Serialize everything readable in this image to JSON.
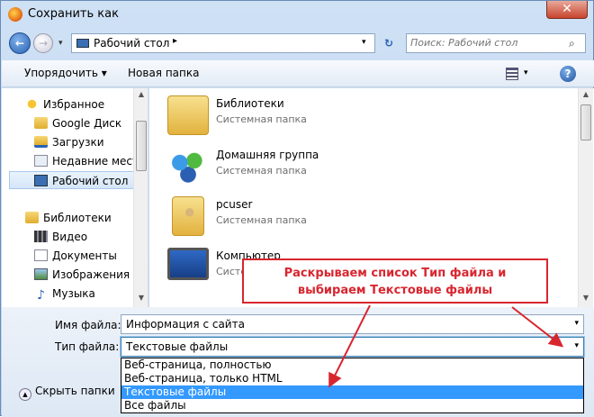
{
  "window": {
    "title": "Сохранить как",
    "close_glyph": "✕"
  },
  "nav": {
    "address_text": "Рабочий стол",
    "address_separator": "▸",
    "search_placeholder": "Поиск: Рабочий стол"
  },
  "toolbar": {
    "organize_label": "Упорядочить ▾",
    "new_folder_label": "Новая папка",
    "help_glyph": "?"
  },
  "sidebar": {
    "items": [
      {
        "label": "Избранное",
        "icon": "star-icon"
      },
      {
        "label": "Google Диск",
        "icon": "folder-icon"
      },
      {
        "label": "Загрузки",
        "icon": "downloads-icon"
      },
      {
        "label": "Недавние места",
        "icon": "recent-places-icon"
      },
      {
        "label": "Рабочий стол",
        "icon": "desktop-icon",
        "selected": true
      },
      {
        "label": "Библиотеки",
        "icon": "libraries-icon"
      },
      {
        "label": "Видео",
        "icon": "video-icon"
      },
      {
        "label": "Документы",
        "icon": "documents-icon"
      },
      {
        "label": "Изображения",
        "icon": "pictures-icon"
      },
      {
        "label": "Музыка",
        "icon": "music-icon"
      }
    ]
  },
  "files": [
    {
      "name": "Библиотеки",
      "desc": "Системная папка",
      "icon": "libraries-folder-icon"
    },
    {
      "name": "Домашняя группа",
      "desc": "Системная папка",
      "icon": "homegroup-icon"
    },
    {
      "name": "pcuser",
      "desc": "Системная папка",
      "icon": "user-folder-icon"
    },
    {
      "name": "Компьютер",
      "desc": "Системная папка",
      "icon": "computer-icon"
    }
  ],
  "form": {
    "filename_label": "Имя файла:",
    "filename_value": "Информация с сайта",
    "filetype_label": "Тип файла:",
    "filetype_value": "Текстовые файлы",
    "options": [
      "Веб-страница, полностью",
      "Веб-страница, только HTML",
      "Текстовые файлы",
      "Все файлы"
    ],
    "selected_option": 2,
    "hide_folders_label": "Скрыть папки"
  },
  "callout": {
    "line1": "Раскрываем список Тип файла и",
    "line2": "выбираем Текстовые файлы",
    "color": "#d8262f"
  }
}
